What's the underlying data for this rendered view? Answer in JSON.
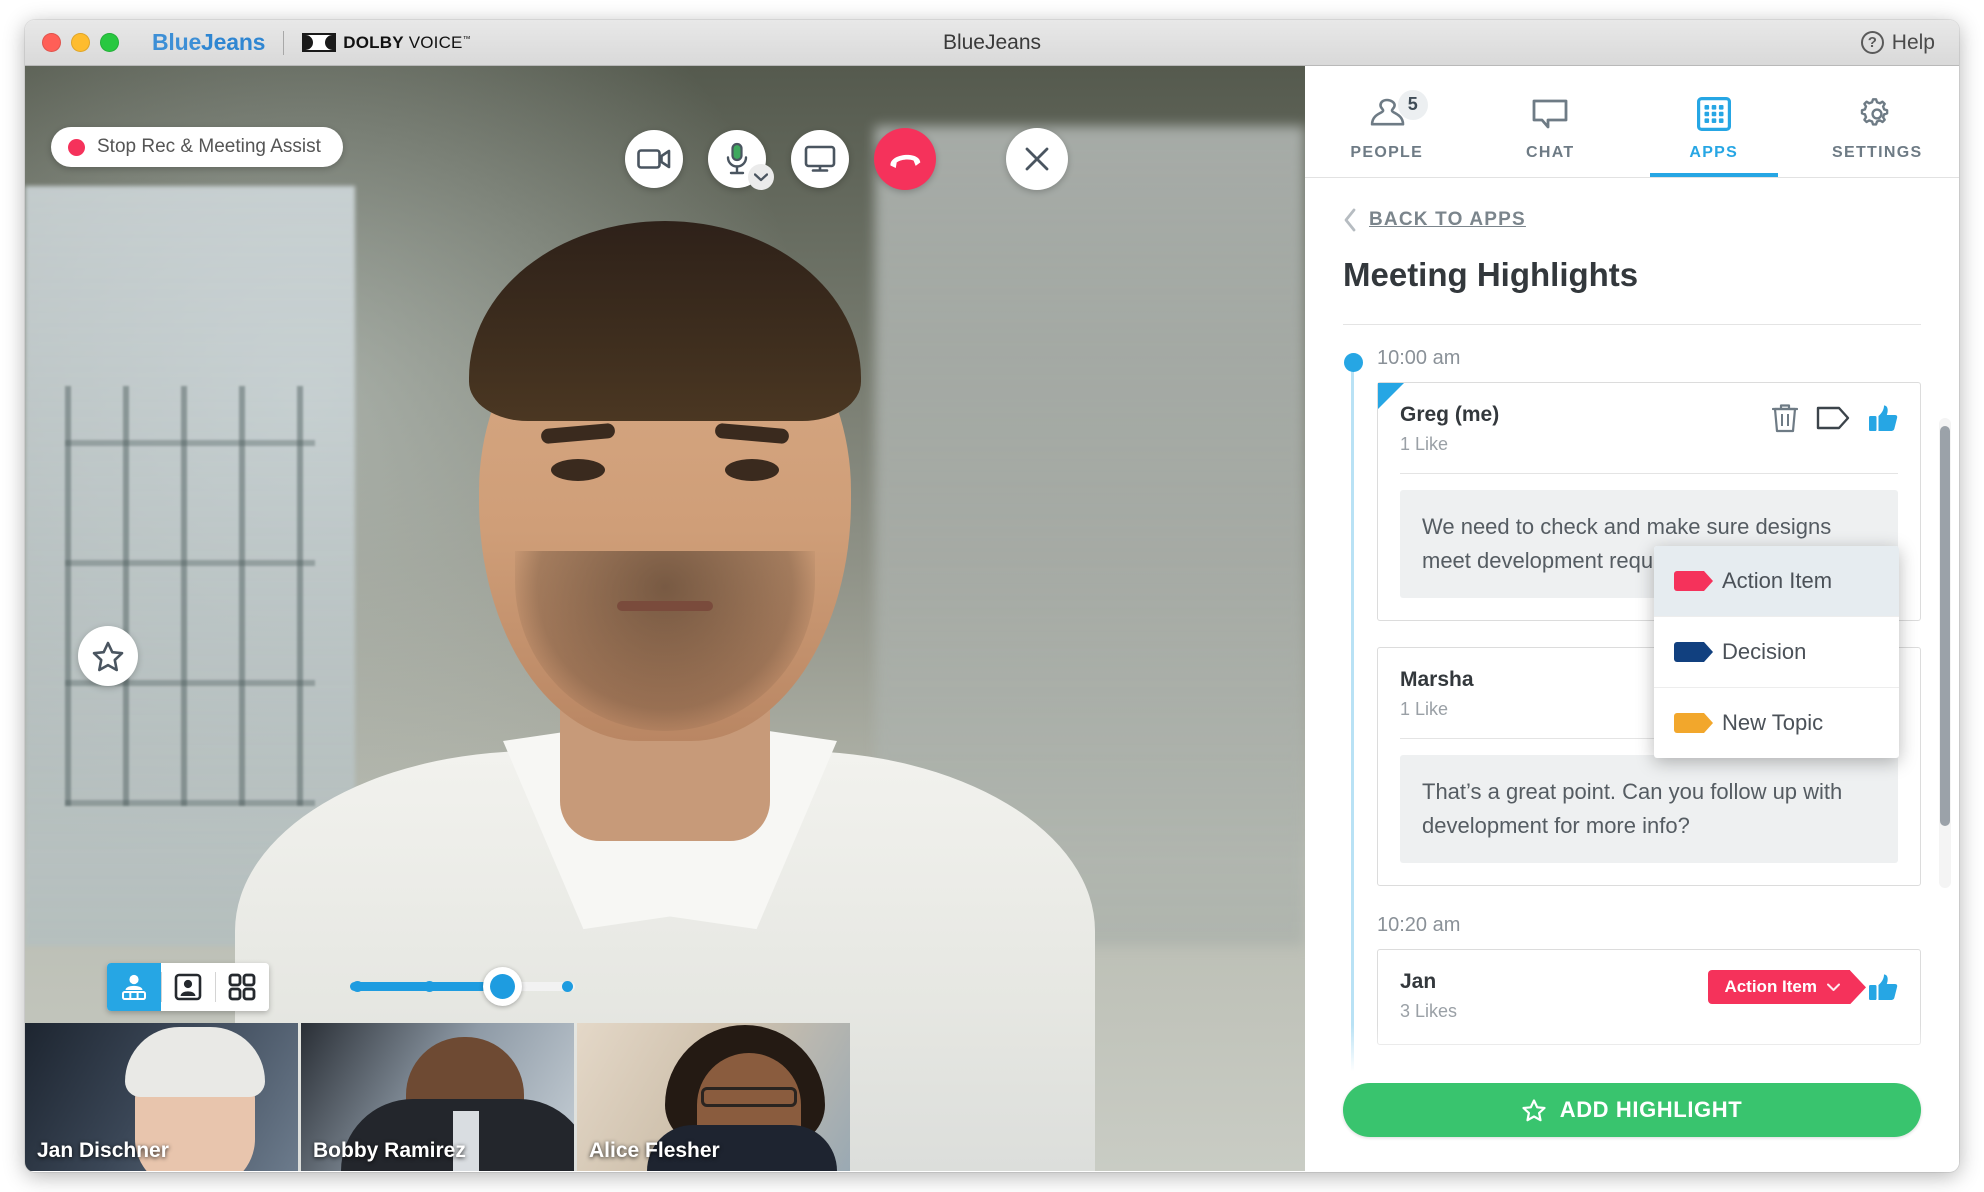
{
  "titlebar": {
    "brand_blue": "Blue",
    "brand_jeans": "Jeans",
    "dolby_bold": "DOLBY",
    "dolby_light": " VOICE",
    "dolby_tm": "™",
    "window_title": "BlueJeans",
    "help_label": "Help",
    "help_icon": "question-circle-icon"
  },
  "video": {
    "recording_pill_label": "Stop Rec & Meeting Assist",
    "recording_dot_color": "#f5325b",
    "controls": [
      {
        "name": "camera-button",
        "icon": "video-camera-icon"
      },
      {
        "name": "microphone-button",
        "icon": "microphone-icon"
      },
      {
        "name": "screen-share-button",
        "icon": "monitor-icon"
      },
      {
        "name": "hangup-button",
        "icon": "phone-hangup-icon"
      },
      {
        "name": "close-panel-button",
        "icon": "close-x-icon"
      }
    ],
    "favorite_icon": "star-outline-icon",
    "layout_modes": [
      {
        "name": "layout-speaker-with-filmstrip",
        "icon": "person-with-filmstrip-icon",
        "active": true
      },
      {
        "name": "layout-single-speaker",
        "icon": "person-framed-icon",
        "active": false
      },
      {
        "name": "layout-grid",
        "icon": "grid-four-icon",
        "active": false
      }
    ],
    "slider": {
      "name": "tile-size-slider",
      "value": 3,
      "min": 1,
      "max": 4
    },
    "participants": [
      {
        "name": "Jan Dischner"
      },
      {
        "name": "Bobby Ramirez"
      },
      {
        "name": "Alice Flesher"
      }
    ]
  },
  "panel": {
    "tabs": [
      {
        "label": "PEOPLE",
        "icon": "person-icon",
        "badge": "5",
        "active": false
      },
      {
        "label": "CHAT",
        "icon": "chat-bubble-icon",
        "active": false
      },
      {
        "label": "APPS",
        "icon": "apps-grid-icon",
        "active": true
      },
      {
        "label": "SETTINGS",
        "icon": "gear-icon",
        "active": false
      }
    ],
    "back_link": "BACK TO APPS",
    "back_icon": "chevron-left-icon",
    "title": "Meeting Highlights",
    "accent_color": "#26a6e4",
    "groups": [
      {
        "time": "10:00 am",
        "cards": [
          {
            "author": "Greg (me)",
            "likes": "1 Like",
            "text": "We need to check and make sure designs meet development requirements.",
            "flagged": true,
            "actions": [
              "trash-icon",
              "tag-icon",
              "thumbs-up-icon"
            ],
            "tag": null
          },
          {
            "author": "Marsha",
            "likes": "1 Like",
            "text": "That’s a great point. Can you follow up with development for more info?",
            "flagged": false,
            "actions": [
              "tag-icon",
              "thumbs-up-icon"
            ],
            "tag": null
          }
        ]
      },
      {
        "time": "10:20 am",
        "cards": [
          {
            "author": "Jan",
            "likes": "3 Likes",
            "text": "",
            "flagged": false,
            "actions": [
              "thumbs-up-icon"
            ],
            "tag": {
              "label": "Action Item",
              "color": "#f5325b",
              "caret_icon": "chevron-down-icon"
            }
          }
        ]
      }
    ],
    "tag_menu": {
      "items": [
        {
          "label": "Action Item",
          "color": "#f5325b",
          "swatch_icon": "tag-icon",
          "hovered": true
        },
        {
          "label": "Decision",
          "color": "#11407f",
          "swatch_icon": "tag-icon",
          "hovered": false
        },
        {
          "label": "New Topic",
          "color": "#f2a72c",
          "swatch_icon": "tag-icon",
          "hovered": false
        }
      ]
    },
    "footer": {
      "add_highlight_label": "ADD HIGHLIGHT",
      "add_highlight_icon": "star-outline-icon",
      "add_highlight_color": "#39c46e"
    }
  }
}
